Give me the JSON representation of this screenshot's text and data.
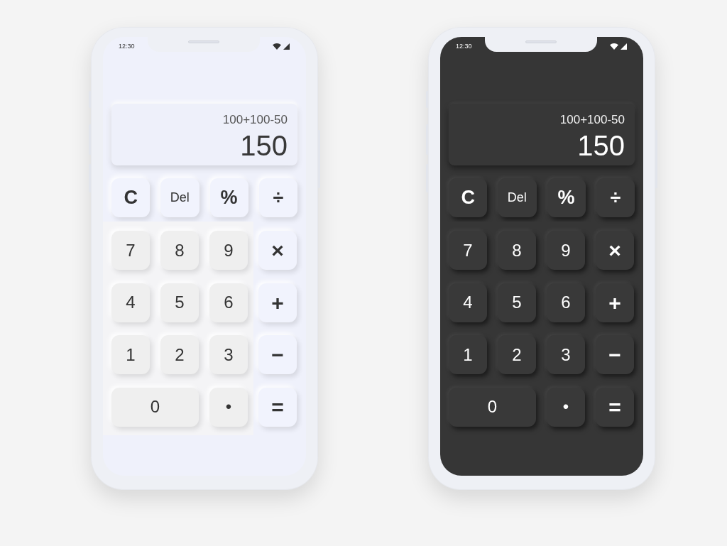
{
  "phones": [
    {
      "dark_mode": false,
      "status_bar": {
        "time": "12:30"
      },
      "display": {
        "expression": "100+100-50",
        "result": "150"
      },
      "function_keys": [
        {
          "label": "C"
        },
        {
          "label": "Del"
        },
        {
          "label": "%"
        },
        {
          "label": "÷"
        }
      ],
      "digit_keys": [
        {
          "label": "7"
        },
        {
          "label": "8"
        },
        {
          "label": "9"
        },
        {
          "label": "4"
        },
        {
          "label": "5"
        },
        {
          "label": "6"
        },
        {
          "label": "1"
        },
        {
          "label": "2"
        },
        {
          "label": "3"
        },
        {
          "label": "0",
          "wide": true
        },
        {
          "label": "•"
        }
      ],
      "operator_keys": [
        {
          "label": "×"
        },
        {
          "label": "+"
        },
        {
          "label": "−"
        },
        {
          "label": "="
        }
      ]
    },
    {
      "dark_mode": true,
      "status_bar": {
        "time": "12:30"
      },
      "display": {
        "expression": "100+100-50",
        "result": "150"
      },
      "function_keys": [
        {
          "label": "C"
        },
        {
          "label": "Del"
        },
        {
          "label": "%"
        },
        {
          "label": "÷"
        }
      ],
      "digit_keys": [
        {
          "label": "7"
        },
        {
          "label": "8"
        },
        {
          "label": "9"
        },
        {
          "label": "4"
        },
        {
          "label": "5"
        },
        {
          "label": "6"
        },
        {
          "label": "1"
        },
        {
          "label": "2"
        },
        {
          "label": "3"
        },
        {
          "label": "0",
          "wide": true
        },
        {
          "label": "•"
        }
      ],
      "operator_keys": [
        {
          "label": "×"
        },
        {
          "label": "+"
        },
        {
          "label": "−"
        },
        {
          "label": "="
        }
      ]
    }
  ]
}
